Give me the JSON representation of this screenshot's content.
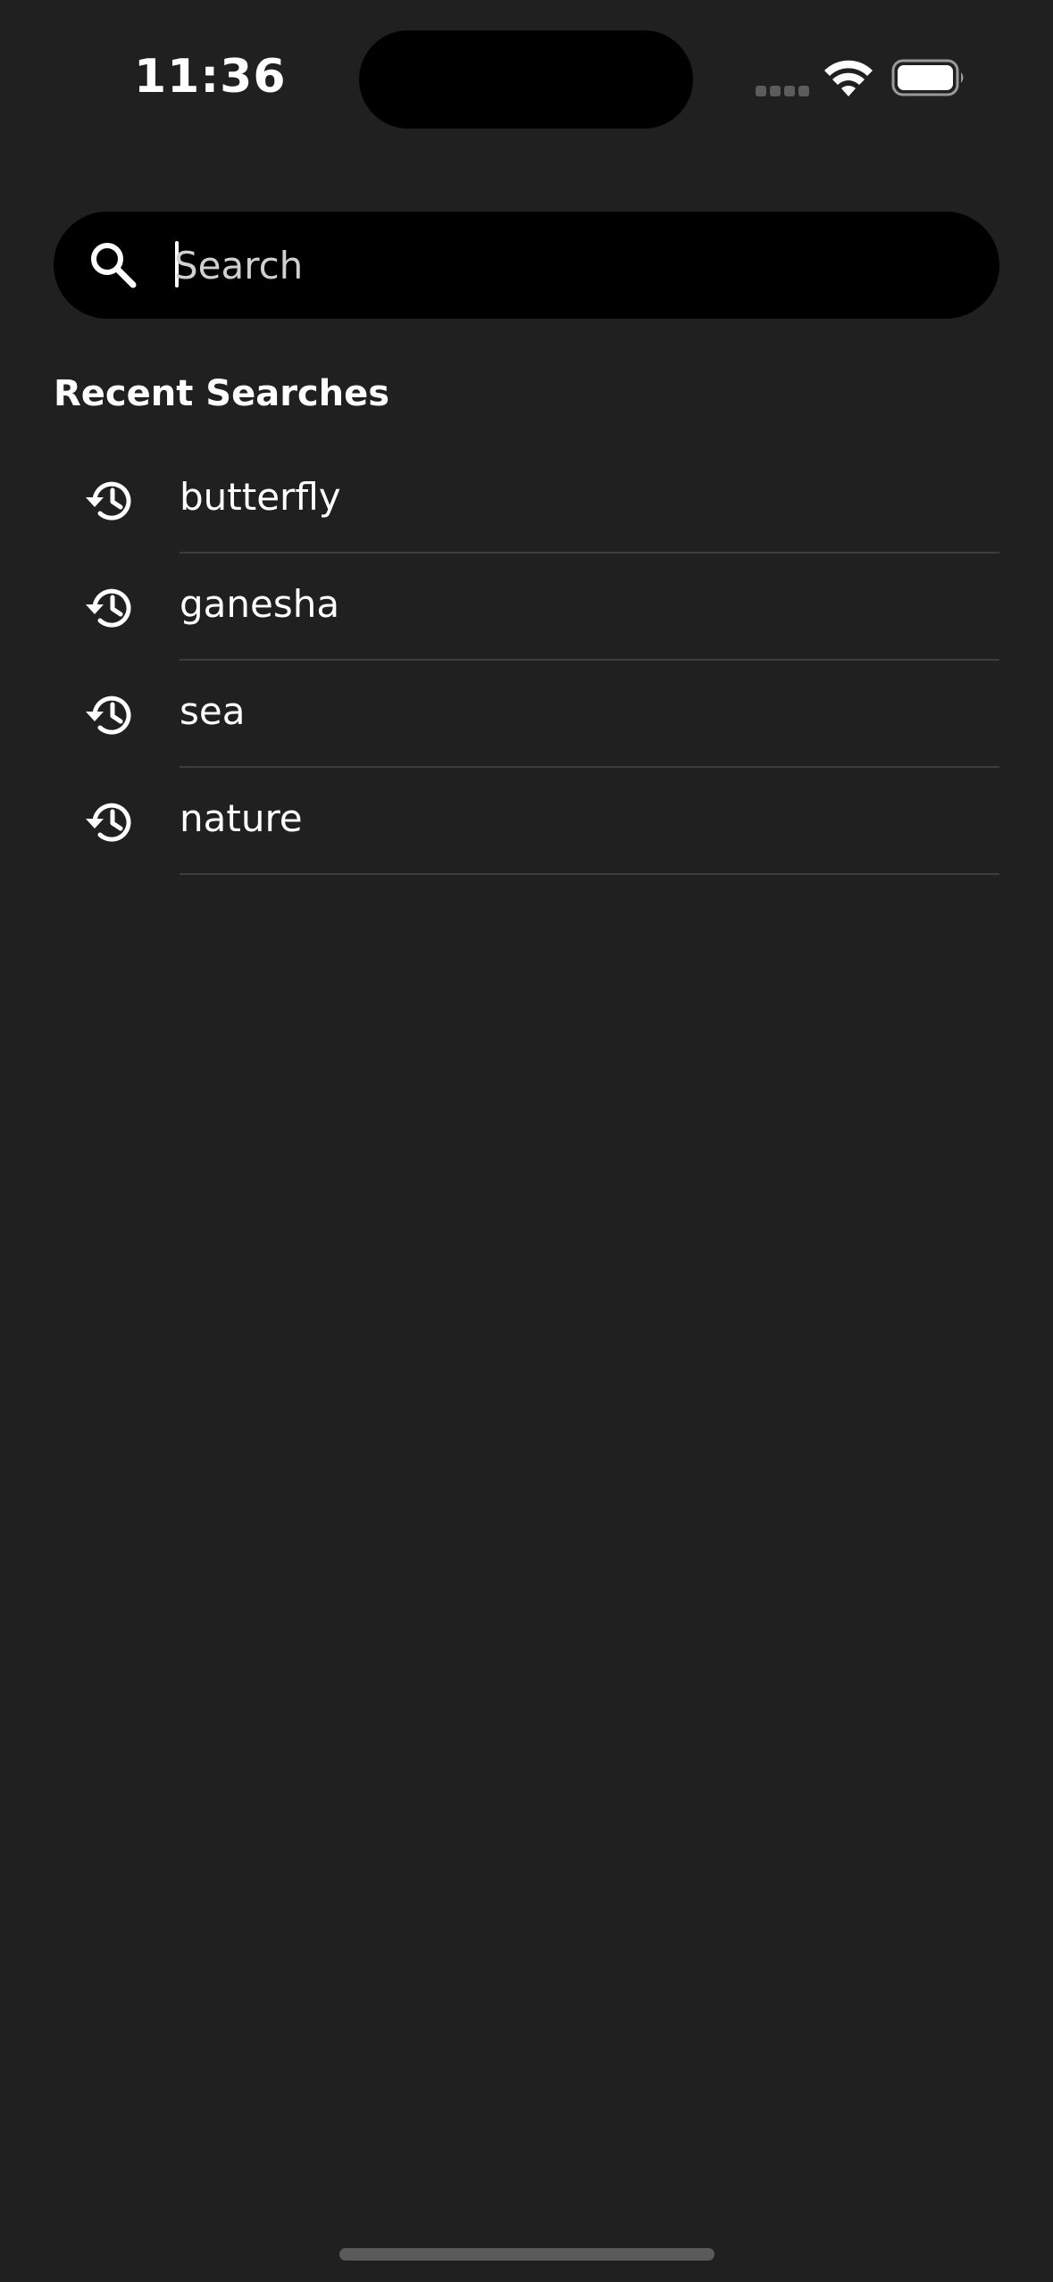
{
  "status_bar": {
    "time": "11:36"
  },
  "search": {
    "placeholder": "Search",
    "value": ""
  },
  "recent": {
    "title": "Recent Searches",
    "items": [
      {
        "label": "butterfly",
        "icon": "history-icon"
      },
      {
        "label": "ganesha",
        "icon": "history-icon"
      },
      {
        "label": "sea",
        "icon": "history-icon"
      },
      {
        "label": "nature",
        "icon": "history-icon"
      }
    ]
  },
  "colors": {
    "background": "#202020",
    "search_bar": "#000000",
    "text": "#ffffff",
    "divider": "#3d3d3d"
  }
}
